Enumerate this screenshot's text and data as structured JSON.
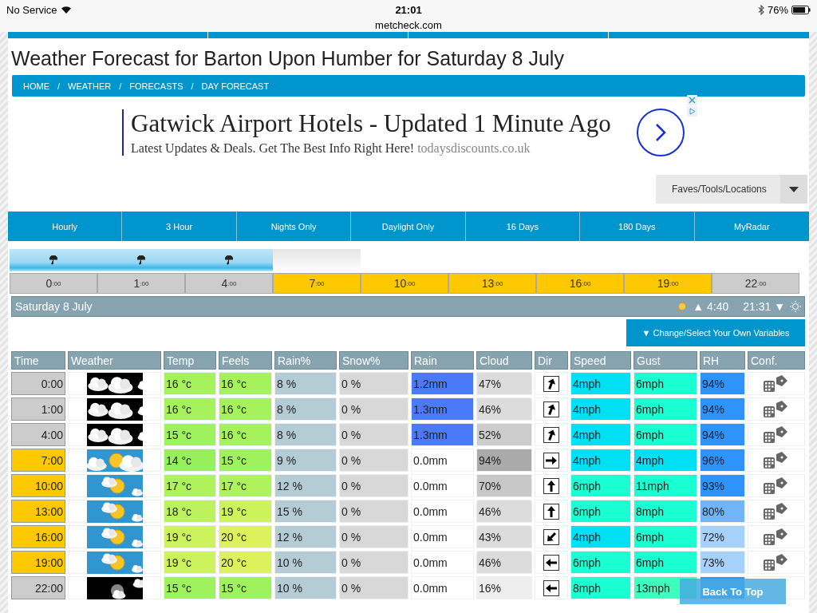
{
  "status_bar": {
    "carrier": "No Service",
    "time": "21:01",
    "battery": "76%",
    "url": "metcheck.com"
  },
  "title": "Weather Forecast for Barton Upon Humber for Saturday 8 July",
  "breadcrumb": [
    {
      "label": "HOME"
    },
    {
      "separator": "/",
      "label": "WEATHER"
    },
    {
      "separator": "/",
      "label": "FORECASTS"
    },
    {
      "separator": "/",
      "label": "DAY FORECAST"
    }
  ],
  "ad": {
    "headline": "Gatwick Airport Hotels - Updated 1 Minute Ago",
    "text": "Latest Updates & Deals. Get The Best Info Right Here!",
    "domain": "todaysdiscounts.co.uk"
  },
  "faves": {
    "label": "Faves/Tools/Locations"
  },
  "tabs": [
    "Hourly",
    "3 Hour",
    "Nights Only",
    "Daylight Only",
    "16 Days",
    "180 Days",
    "MyRadar"
  ],
  "rain_strip": {
    "level": 0.75
  },
  "hours": [
    {
      "hour": "0",
      "min": ":00",
      "daylight": false
    },
    {
      "hour": "1",
      "min": ":00",
      "daylight": false
    },
    {
      "hour": "4",
      "min": ":00",
      "daylight": false
    },
    {
      "hour": "7",
      "min": ":00",
      "daylight": true
    },
    {
      "hour": "10",
      "min": ":00",
      "daylight": true
    },
    {
      "hour": "13",
      "min": ":00",
      "daylight": true
    },
    {
      "hour": "16",
      "min": ":00",
      "daylight": true
    },
    {
      "hour": "19",
      "min": ":00",
      "daylight": true
    },
    {
      "hour": "22",
      "min": ":00",
      "daylight": false
    }
  ],
  "day_bar": {
    "date": "Saturday 8 July",
    "sunrise": "▲ 4:40",
    "sunset": "21:31 ▼"
  },
  "variables_button": "▼ Change/Select Your Own Variables",
  "columns": [
    "Time",
    "Weather",
    "Temp",
    "Feels",
    "Rain%",
    "Snow%",
    "Rain",
    "Cloud",
    "Dir",
    "Speed",
    "Gust",
    "RH",
    "Conf."
  ],
  "rows": [
    {
      "time": "0:00",
      "daylight": false,
      "weather": {
        "kind": "night-cloud"
      },
      "temp": {
        "text": "16 °c",
        "color": "#a6f25c"
      },
      "feels": {
        "text": "16 °c",
        "color": "#a6f25c"
      },
      "rain_pct": "8 %",
      "snow_pct": "0 %",
      "rain": {
        "text": "1.2mm",
        "color": "#4a7afa"
      },
      "cloud": {
        "text": "47%",
        "color": "#dcdcdc"
      },
      "dir": {
        "kind": "up-right"
      },
      "speed": {
        "text": "4mph",
        "color": "#00e0f5"
      },
      "gust": {
        "text": "6mph",
        "color": "#1affd2"
      },
      "rh": {
        "text": "94%",
        "color": "#2e93fa"
      }
    },
    {
      "time": "1:00",
      "daylight": false,
      "weather": {
        "kind": "night-cloud"
      },
      "temp": {
        "text": "16 °c",
        "color": "#a6f25c"
      },
      "feels": {
        "text": "16 °c",
        "color": "#a6f25c"
      },
      "rain_pct": "8 %",
      "snow_pct": "0 %",
      "rain": {
        "text": "1.3mm",
        "color": "#4a7afa"
      },
      "cloud": {
        "text": "46%",
        "color": "#dcdcdc"
      },
      "dir": {
        "kind": "up-right"
      },
      "speed": {
        "text": "4mph",
        "color": "#00e0f5"
      },
      "gust": {
        "text": "6mph",
        "color": "#1affd2"
      },
      "rh": {
        "text": "94%",
        "color": "#2e93fa"
      }
    },
    {
      "time": "4:00",
      "daylight": false,
      "weather": {
        "kind": "night-cloud"
      },
      "temp": {
        "text": "15 °c",
        "color": "#9ef25c"
      },
      "feels": {
        "text": "16 °c",
        "color": "#a6f25c"
      },
      "rain_pct": "8 %",
      "snow_pct": "0 %",
      "rain": {
        "text": "1.3mm",
        "color": "#4a7afa"
      },
      "cloud": {
        "text": "52%",
        "color": "#cccccc"
      },
      "dir": {
        "kind": "up-right"
      },
      "speed": {
        "text": "4mph",
        "color": "#00e0f5"
      },
      "gust": {
        "text": "6mph",
        "color": "#1affd2"
      },
      "rh": {
        "text": "94%",
        "color": "#2e93fa"
      }
    },
    {
      "time": "7:00",
      "daylight": true,
      "weather": {
        "kind": "dawn-sun-cloud"
      },
      "temp": {
        "text": "14 °c",
        "color": "#96f05c"
      },
      "feels": {
        "text": "15 °c",
        "color": "#9ef25c"
      },
      "rain_pct": "9 %",
      "snow_pct": "0 %",
      "rain": {
        "text": "0.0mm",
        "color": "#ffffff"
      },
      "cloud": {
        "text": "94%",
        "color": "#aaaaaa"
      },
      "dir": {
        "kind": "right"
      },
      "speed": {
        "text": "4mph",
        "color": "#00e0f5"
      },
      "gust": {
        "text": "4mph",
        "color": "#00e0f5"
      },
      "rh": {
        "text": "96%",
        "color": "#2e93fa"
      }
    },
    {
      "time": "10:00",
      "daylight": true,
      "weather": {
        "kind": "sun-cloud"
      },
      "temp": {
        "text": "17 °c",
        "color": "#aef25c"
      },
      "feels": {
        "text": "17 °c",
        "color": "#aef25c"
      },
      "rain_pct": "12 %",
      "snow_pct": "0 %",
      "rain": {
        "text": "0.0mm",
        "color": "#ffffff"
      },
      "cloud": {
        "text": "70%",
        "color": "#c8c8c8"
      },
      "dir": {
        "kind": "up"
      },
      "speed": {
        "text": "6mph",
        "color": "#1affd2"
      },
      "gust": {
        "text": "11mph",
        "color": "#1affd2"
      },
      "rh": {
        "text": "93%",
        "color": "#2e93fa"
      }
    },
    {
      "time": "13:00",
      "daylight": true,
      "weather": {
        "kind": "sun-cloud"
      },
      "temp": {
        "text": "18 °c",
        "color": "#bcf25c"
      },
      "feels": {
        "text": "19 °c",
        "color": "#ccf25c"
      },
      "rain_pct": "15 %",
      "snow_pct": "0 %",
      "rain": {
        "text": "0.0mm",
        "color": "#ffffff"
      },
      "cloud": {
        "text": "46%",
        "color": "#dcdcdc"
      },
      "dir": {
        "kind": "up"
      },
      "speed": {
        "text": "6mph",
        "color": "#1affd2"
      },
      "gust": {
        "text": "8mph",
        "color": "#1affd2"
      },
      "rh": {
        "text": "80%",
        "color": "#70b5fa"
      }
    },
    {
      "time": "16:00",
      "daylight": true,
      "weather": {
        "kind": "sun-cloud"
      },
      "temp": {
        "text": "19 °c",
        "color": "#ccf25c"
      },
      "feels": {
        "text": "20 °c",
        "color": "#dcf25c"
      },
      "rain_pct": "12 %",
      "snow_pct": "0 %",
      "rain": {
        "text": "0.0mm",
        "color": "#ffffff"
      },
      "cloud": {
        "text": "43%",
        "color": "#dcdcdc"
      },
      "dir": {
        "kind": "down-left"
      },
      "speed": {
        "text": "4mph",
        "color": "#00e0f5"
      },
      "gust": {
        "text": "6mph",
        "color": "#1affd2"
      },
      "rh": {
        "text": "72%",
        "color": "#a6d1fa"
      }
    },
    {
      "time": "19:00",
      "daylight": true,
      "weather": {
        "kind": "sun-cloud"
      },
      "temp": {
        "text": "19 °c",
        "color": "#ccf25c"
      },
      "feels": {
        "text": "20 °c",
        "color": "#dcf25c"
      },
      "rain_pct": "10 %",
      "snow_pct": "0 %",
      "rain": {
        "text": "0.0mm",
        "color": "#ffffff"
      },
      "cloud": {
        "text": "46%",
        "color": "#dcdcdc"
      },
      "dir": {
        "kind": "left"
      },
      "speed": {
        "text": "6mph",
        "color": "#1affd2"
      },
      "gust": {
        "text": "6mph",
        "color": "#1affd2"
      },
      "rh": {
        "text": "73%",
        "color": "#a6d1fa"
      }
    },
    {
      "time": "22:00",
      "daylight": false,
      "weather": {
        "kind": "night-moon-cloud"
      },
      "temp": {
        "text": "15 °c",
        "color": "#9ef25c"
      },
      "feels": {
        "text": "15 °c",
        "color": "#9ef25c"
      },
      "rain_pct": "10 %",
      "snow_pct": "0 %",
      "rain": {
        "text": "0.0mm",
        "color": "#ffffff"
      },
      "cloud": {
        "text": "16%",
        "color": "#eeeeee"
      },
      "dir": {
        "kind": "left"
      },
      "speed": {
        "text": "8mph",
        "color": "#1affd2"
      },
      "gust": {
        "text": "13mph",
        "color": "#3dffbe"
      },
      "rh": {
        "color": "#2e93fa"
      }
    }
  ],
  "back_to_top": "Back To Top"
}
